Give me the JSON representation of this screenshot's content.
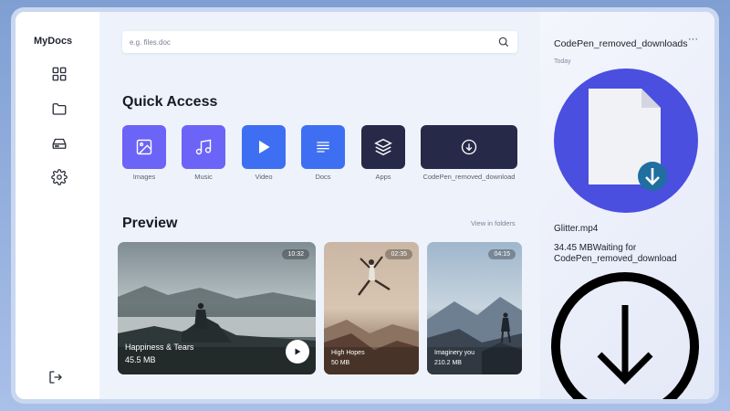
{
  "app": {
    "brand": "MyDocs"
  },
  "sidebar": {
    "items": [
      {
        "icon": "grid-icon"
      },
      {
        "icon": "folder-icon"
      },
      {
        "icon": "drive-icon"
      },
      {
        "icon": "gear-icon"
      }
    ],
    "logout_icon": "logout-icon"
  },
  "search": {
    "placeholder": "e.g. files.doc",
    "value": "",
    "icon": "search-icon"
  },
  "quick_access": {
    "title": "Quick Access",
    "items": [
      {
        "label": "Images",
        "icon": "image-icon",
        "color": "#6c63f7"
      },
      {
        "label": "Music",
        "icon": "music-icon",
        "color": "#6c63f7"
      },
      {
        "label": "Video",
        "icon": "play-icon",
        "color": "#3e6ff2"
      },
      {
        "label": "Docs",
        "icon": "docs-icon",
        "color": "#3e6ff2"
      },
      {
        "label": "Apps",
        "icon": "layers-icon",
        "color": "#262a48"
      },
      {
        "label": "CodePen_removed_download",
        "icon": "download-icon",
        "color": "#262a48"
      }
    ]
  },
  "preview": {
    "title": "Preview",
    "view_link": "View in folders",
    "cards": [
      {
        "title": "Happiness & Tears",
        "size": "45.5 MB",
        "duration": "10:32"
      },
      {
        "title": "High Hopes",
        "size": "50 MB",
        "duration": "02:35"
      },
      {
        "title": "Imaginery you",
        "size": "210.2 MB",
        "duration": "04:15"
      }
    ]
  },
  "downloads": {
    "title": "CodePen_removed_downloads",
    "more": "···",
    "date_label": "Today",
    "file_name": "Glitter.mp4",
    "status": "34.45 MBWaiting for CodePen_removed_download",
    "colors": {
      "circle": "#4a4fe0",
      "badge": "#1f6fa0"
    }
  }
}
